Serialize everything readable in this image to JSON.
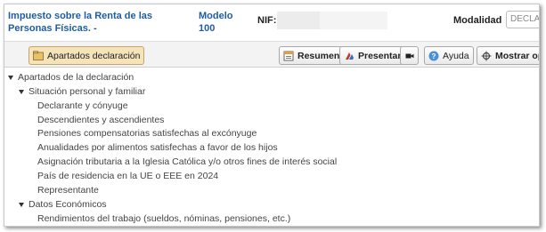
{
  "header": {
    "title": "Impuesto sobre la Renta de las Personas Físicas. -",
    "model_label": "Modelo",
    "model_number": "100",
    "nif_label": "NIF:",
    "modalidad_label": "Modalidad",
    "modalidad_value": "DECLA"
  },
  "toolbar": {
    "apartados": "Apartados declaración",
    "resumen": "Resumen",
    "presentar": "Presentar",
    "ayuda": "Ayuda",
    "mostrar": "Mostrar op"
  },
  "tree": {
    "root": "Apartados de la declaración",
    "group1": "Situación personal y familiar",
    "items1": [
      "Declarante y cónyuge",
      "Descendientes y ascendientes",
      "Pensiones compensatorias satisfechas al excónyuge",
      "Anualidades por alimentos satisfechas a favor de los hijos",
      "Asignación tributaria a la Iglesia Católica y/o otros fines de interés social",
      "País de residencia en la UE o EEE en 2024",
      "Representante"
    ],
    "group2": "Datos Económicos",
    "items2": [
      "Rendimientos del trabajo (sueldos, nóminas, pensiones, etc.)"
    ]
  },
  "colors": {
    "title_blue": "#1d5da7",
    "active_button": "#f5e3b9",
    "help_icon": "#4a8fd8"
  },
  "icons": [
    "folder-icon",
    "summary-icon",
    "submit-icon",
    "camera-icon",
    "help-icon",
    "options-icon",
    "expand-triangle-icon"
  ]
}
